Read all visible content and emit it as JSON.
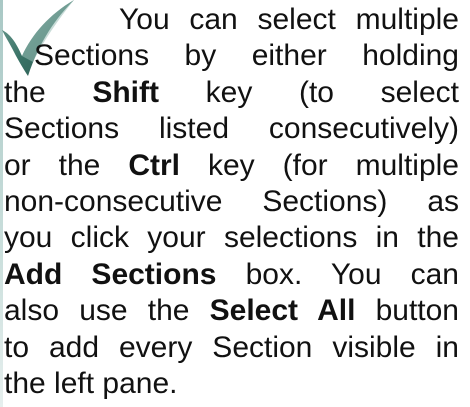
{
  "tip": {
    "icon": "checkmark-icon",
    "icon_color": "#2f6b5e",
    "lines": [
      {
        "parts": [
          {
            "t": "You can select multiple",
            "b": false
          }
        ]
      },
      {
        "parts": [
          {
            "t": "Sections by either holding",
            "b": false
          }
        ]
      },
      {
        "parts": [
          {
            "t": "the ",
            "b": false
          },
          {
            "t": "Shift",
            "b": true
          },
          {
            "t": " key (to select",
            "b": false
          }
        ]
      },
      {
        "parts": [
          {
            "t": "Sections listed consecutively)",
            "b": false
          }
        ]
      },
      {
        "parts": [
          {
            "t": "or the ",
            "b": false
          },
          {
            "t": "Ctrl",
            "b": true
          },
          {
            "t": " key (for multiple",
            "b": false
          }
        ]
      },
      {
        "parts": [
          {
            "t": "non-consecutive Sections) as",
            "b": false
          }
        ]
      },
      {
        "parts": [
          {
            "t": "you click your selections in the",
            "b": false
          }
        ]
      },
      {
        "parts": [
          {
            "t": "Add Sections",
            "b": true
          },
          {
            "t": " box. You can",
            "b": false
          }
        ]
      },
      {
        "parts": [
          {
            "t": "also use the ",
            "b": false
          },
          {
            "t": "Select All",
            "b": true
          },
          {
            "t": " button",
            "b": false
          }
        ]
      },
      {
        "parts": [
          {
            "t": "to add every Section visible in",
            "b": false
          }
        ]
      },
      {
        "parts": [
          {
            "t": "the left pane.",
            "b": false
          }
        ]
      }
    ]
  }
}
